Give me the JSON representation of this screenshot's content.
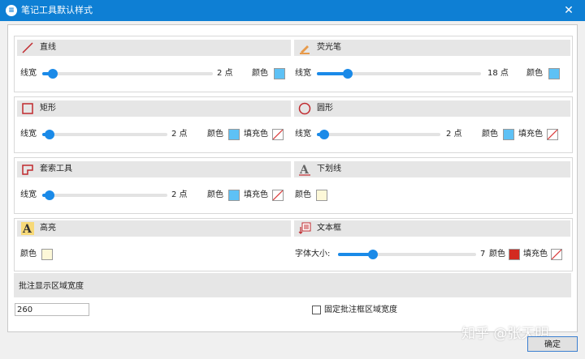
{
  "window": {
    "title": "笔记工具默认样式",
    "close_glyph": "✕",
    "app_icon_glyph": "≡"
  },
  "colors": {
    "accent": "#1a8ae8",
    "light_blue_swatch": "#5ec1f5",
    "cream_swatch": "#fdf8d8",
    "red_swatch": "#d32a20",
    "icon_red": "#c0282d"
  },
  "tools": {
    "line": {
      "name": "直线",
      "width_label": "线宽",
      "width_value": "2 点",
      "width_fraction": 0.06,
      "color_label": "颜色",
      "icon": "diagonal-line-icon"
    },
    "highlighter": {
      "name": "荧光笔",
      "width_label": "线宽",
      "width_value": "18 点",
      "width_fraction": 0.19,
      "color_label": "颜色",
      "icon": "highlighter-pen-icon"
    },
    "rectangle": {
      "name": "矩形",
      "width_label": "线宽",
      "width_value": "2 点",
      "width_fraction": 0.06,
      "color_label": "颜色",
      "fill_label": "填充色",
      "icon": "rectangle-icon"
    },
    "ellipse": {
      "name": "圆形",
      "width_label": "线宽",
      "width_value": "2 点",
      "width_fraction": 0.06,
      "color_label": "颜色",
      "fill_label": "填充色",
      "icon": "circle-icon"
    },
    "lasso": {
      "name": "套索工具",
      "width_label": "线宽",
      "width_value": "2 点",
      "width_fraction": 0.06,
      "color_label": "颜色",
      "fill_label": "填充色",
      "icon": "lasso-shape-icon"
    },
    "underline": {
      "name": "下划线",
      "color_label": "颜色",
      "icon": "underline-a-icon"
    },
    "highlight": {
      "name": "高亮",
      "color_label": "颜色",
      "icon": "highlight-a-icon"
    },
    "textbox": {
      "name": "文本框",
      "font_size_label": "字体大小:",
      "font_size_value": "7",
      "font_size_fraction": 0.25,
      "color_label": "颜色",
      "fill_label": "填充色",
      "icon": "text-box-icon"
    }
  },
  "annotation_area": {
    "title": "批注显示区域宽度",
    "width_value": "260",
    "fixed_checkbox_label": "固定批注框区域宽度",
    "fixed_checked": false
  },
  "buttons": {
    "ok_label": "确定"
  },
  "watermark": "知乎 @张天明"
}
